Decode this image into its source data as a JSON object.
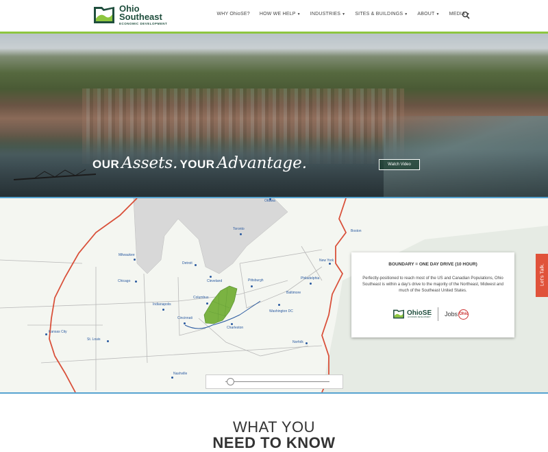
{
  "header": {
    "logo_title_1": "Ohio",
    "logo_title_2": "Southeast",
    "logo_subtitle": "ECONOMIC DEVELOPMENT",
    "nav": [
      {
        "label": "WHY OhioSE?",
        "has_dropdown": false
      },
      {
        "label": "HOW WE HELP",
        "has_dropdown": true
      },
      {
        "label": "INDUSTRIES",
        "has_dropdown": true
      },
      {
        "label": "SITES & BUILDINGS",
        "has_dropdown": true
      },
      {
        "label": "ABOUT",
        "has_dropdown": true
      },
      {
        "label": "MEDIA",
        "has_dropdown": true
      }
    ],
    "search_icon": "search-icon",
    "accent_color": "#8dc63f"
  },
  "hero": {
    "tagline_our": "OUR",
    "tagline_assets": "Assets.",
    "tagline_your": "YOUR",
    "tagline_advantage": "Advantage.",
    "watch_button": "Watch Video"
  },
  "map": {
    "cities": [
      {
        "name": "Ottawa"
      },
      {
        "name": "Toronto"
      },
      {
        "name": "Boston"
      },
      {
        "name": "Milwaukee"
      },
      {
        "name": "Detroit"
      },
      {
        "name": "New York"
      },
      {
        "name": "Cleveland"
      },
      {
        "name": "Pittsburgh"
      },
      {
        "name": "Philadelphia"
      },
      {
        "name": "Chicago"
      },
      {
        "name": "Baltimore"
      },
      {
        "name": "Columbus"
      },
      {
        "name": "Indianapolis"
      },
      {
        "name": "Washington DC"
      },
      {
        "name": "Cincinnati"
      },
      {
        "name": "Charleston"
      },
      {
        "name": "Kansas City"
      },
      {
        "name": "St. Louis"
      },
      {
        "name": "Norfolk"
      },
      {
        "name": "Nashville"
      }
    ],
    "info_title": "BOUNDARY = ONE DAY DRIVE (10 HOUR)",
    "info_body": "Perfectly-positioned to reach most of the US and Canadian Populations, Ohio Southeast is within a day's drive to the majority of the Northeast, Midwest and much of the Southeast United States.",
    "ohiose_logo": "OhioSE",
    "ohiose_logo_sub": "ECONOMIC DEVELOPMENT",
    "jobsohio_logo_a": "Jobs",
    "jobsohio_logo_b": "Ohio",
    "slider_value": 0.05,
    "boundary_color": "#d9503a",
    "region_color": "#7bb342"
  },
  "side_tab": {
    "label": "Let's Talk."
  },
  "section": {
    "heading_line1": "WHAT YOU",
    "heading_line2": "NEED TO KNOW"
  }
}
